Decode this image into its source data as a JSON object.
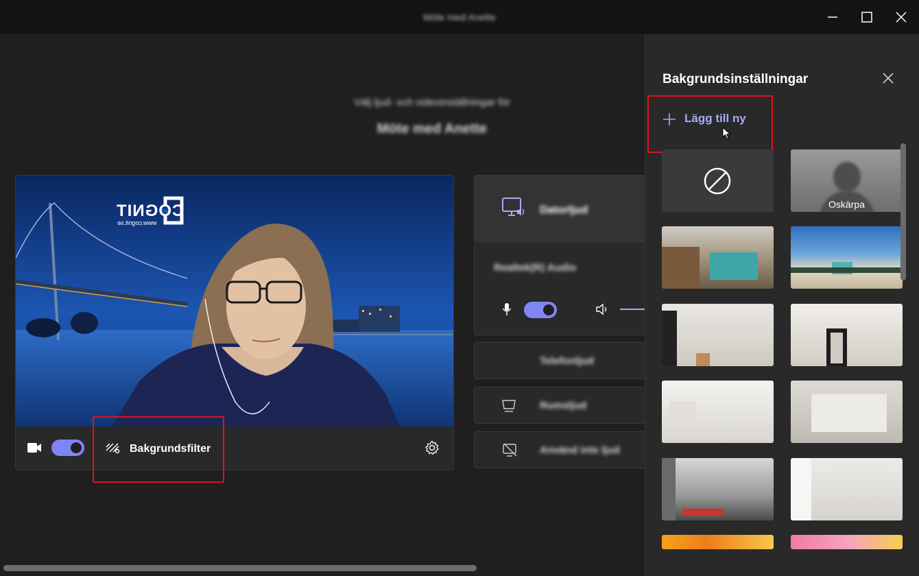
{
  "window": {
    "title": "Möte med Anette",
    "controls": {
      "minimize": "minimize-icon",
      "maximize": "maximize-icon",
      "close": "close-icon"
    }
  },
  "prejoin": {
    "subtitle": "Välj ljud- och videoinställningar för",
    "meeting_title": "Möte med Anette",
    "video_overlay_logo": "COGNIT",
    "video_overlay_url": "www.cognit.se",
    "camera_on": true,
    "background_filter_label": "Bakgrundsfilter"
  },
  "audio_options": {
    "computer_audio": "Datorljud",
    "device_label": "Realtek(R) Audio",
    "mic_on": true,
    "phone_audio": "Telefonljud",
    "room_audio": "Rumsljud",
    "no_audio": "Använd inte ljud"
  },
  "background_panel": {
    "title": "Bakgrundsinställningar",
    "add_new_label": "Lägg till ny",
    "blur_label": "Oskärpa",
    "thumbnails": [
      "none-icon",
      "blur",
      "office-lockers",
      "beach-lifeguard",
      "white-room-1",
      "white-room-2",
      "white-loft",
      "white-studio",
      "industrial-loft",
      "plain-room",
      "orange-bubbles",
      "pink-balls"
    ]
  },
  "colors": {
    "accent": "#7f85f5",
    "accent_text": "#a7abf7",
    "highlight": "#e0121d"
  }
}
